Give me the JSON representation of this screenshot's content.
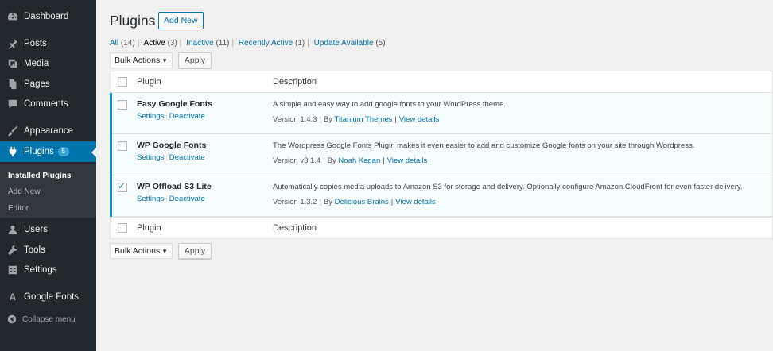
{
  "sidebar": {
    "items": [
      {
        "label": "Dashboard",
        "icon": "dashboard-icon"
      },
      {
        "label": "Posts",
        "icon": "pin-icon"
      },
      {
        "label": "Media",
        "icon": "media-icon"
      },
      {
        "label": "Pages",
        "icon": "pages-icon"
      },
      {
        "label": "Comments",
        "icon": "comments-icon"
      },
      {
        "label": "Appearance",
        "icon": "brush-icon"
      },
      {
        "label": "Plugins",
        "icon": "plug-icon",
        "badge": "5"
      },
      {
        "label": "Users",
        "icon": "user-icon"
      },
      {
        "label": "Tools",
        "icon": "wrench-icon"
      },
      {
        "label": "Settings",
        "icon": "settings-icon"
      },
      {
        "label": "Google Fonts",
        "icon": "font-icon"
      }
    ],
    "submenu": [
      "Installed Plugins",
      "Add New",
      "Editor"
    ],
    "collapse_label": "Collapse menu"
  },
  "header": {
    "title": "Plugins",
    "add_new": "Add New"
  },
  "filters": [
    {
      "label": "All",
      "count": "(14)"
    },
    {
      "label": "Active",
      "count": "(3)"
    },
    {
      "label": "Inactive",
      "count": "(11)"
    },
    {
      "label": "Recently Active",
      "count": "(1)"
    },
    {
      "label": "Update Available",
      "count": "(5)"
    }
  ],
  "bulk": {
    "label": "Bulk Actions",
    "apply": "Apply"
  },
  "table": {
    "col_plugin": "Plugin",
    "col_desc": "Description",
    "rows": [
      {
        "name": "Easy Google Fonts",
        "settings": "Settings",
        "deactivate": "Deactivate",
        "description": "A simple and easy way to add google fonts to your WordPress theme.",
        "version": "Version 1.4.3",
        "by": "By",
        "author": "Titanium Themes",
        "details": "View details",
        "checked": false
      },
      {
        "name": "WP Google Fonts",
        "settings": "Settings",
        "deactivate": "Deactivate",
        "description": "The Wordpress Google Fonts Plugin makes it even easier to add and customize Google fonts on your site through Wordpress.",
        "version": "Version v3.1.4",
        "by": "By",
        "author": "Noah Kagan",
        "details": "View details",
        "checked": false
      },
      {
        "name": "WP Offload S3 Lite",
        "settings": "Settings",
        "deactivate": "Deactivate",
        "description": "Automatically copies media uploads to Amazon S3 for storage and delivery. Optionally configure Amazon CloudFront for even faster delivery.",
        "version": "Version 1.3.2",
        "by": "By",
        "author": "Delicious Brains",
        "details": "View details",
        "checked": true
      }
    ]
  },
  "colors": {
    "sidebar": "#23282d",
    "accent": "#0073aa",
    "active_row": "#f7fcfe",
    "row_border": "#00a0d2"
  }
}
